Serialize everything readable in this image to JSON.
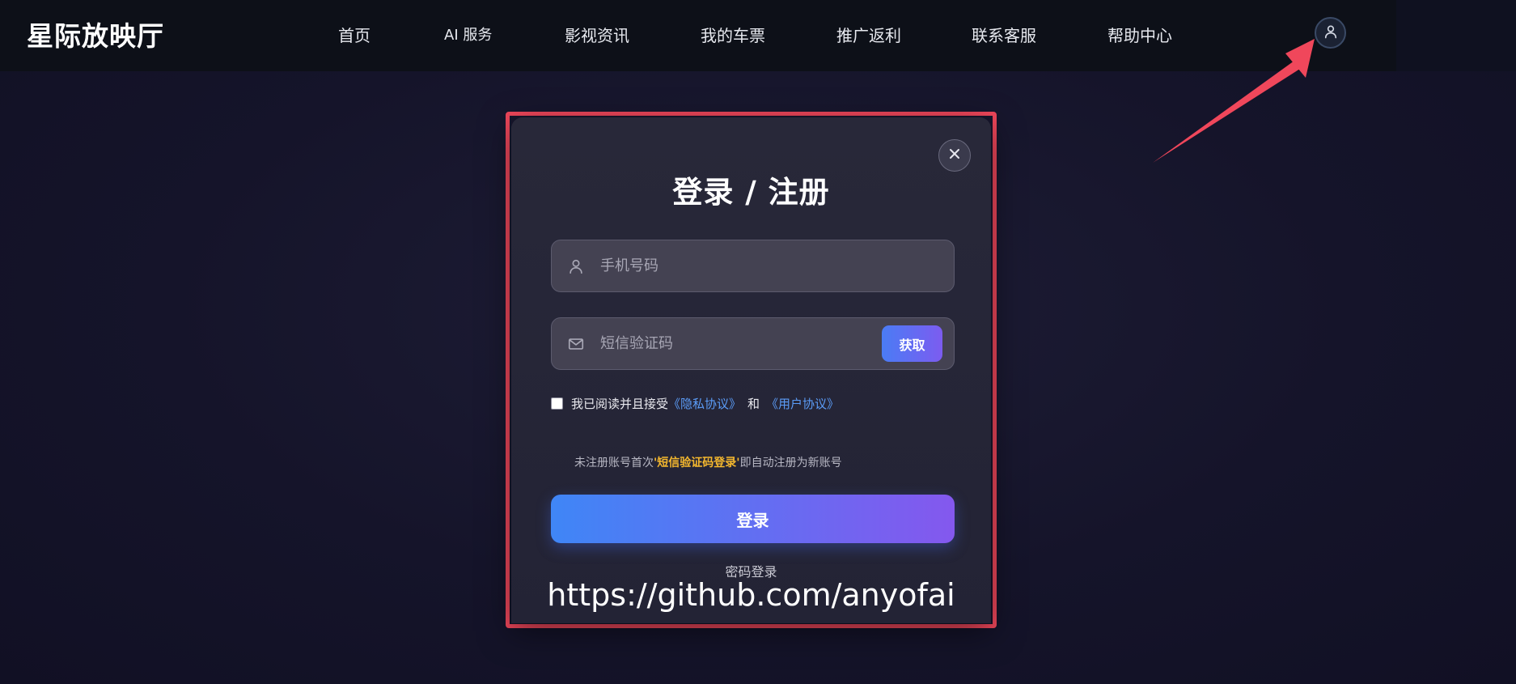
{
  "header": {
    "logo": "星际放映厅",
    "nav": [
      {
        "label": "首页"
      },
      {
        "label": "AI 服务"
      },
      {
        "label": "影视资讯"
      },
      {
        "label": "我的车票"
      },
      {
        "label": "推广返利"
      },
      {
        "label": "联系客服"
      },
      {
        "label": "帮助中心"
      }
    ],
    "avatar_icon": "user-icon"
  },
  "modal": {
    "title": "登录 / 注册",
    "close_icon": "close-icon",
    "phone": {
      "placeholder": "手机号码",
      "value": "",
      "icon": "user-icon"
    },
    "sms": {
      "placeholder": "短信验证码",
      "value": "",
      "icon": "mail-icon",
      "get_code_label": "获取"
    },
    "agreement": {
      "checked": false,
      "prefix": "我已阅读并且接受",
      "privacy_link": "《隐私协议》",
      "and": "和",
      "user_link": "《用户协议》"
    },
    "hint": {
      "before": "未注册账号首次",
      "highlight": "'短信验证码登录'",
      "after": "即自动注册为新账号"
    },
    "login_label": "登录",
    "password_login_label": "密码登录",
    "watermark": "https://github.com/anyofai"
  },
  "colors": {
    "accent_gradient_start": "#3f86f6",
    "accent_gradient_end": "#8458ee",
    "highlight_outline": "#f0475b",
    "hint_highlight": "#f5b82e",
    "link": "#5b9cf7"
  }
}
